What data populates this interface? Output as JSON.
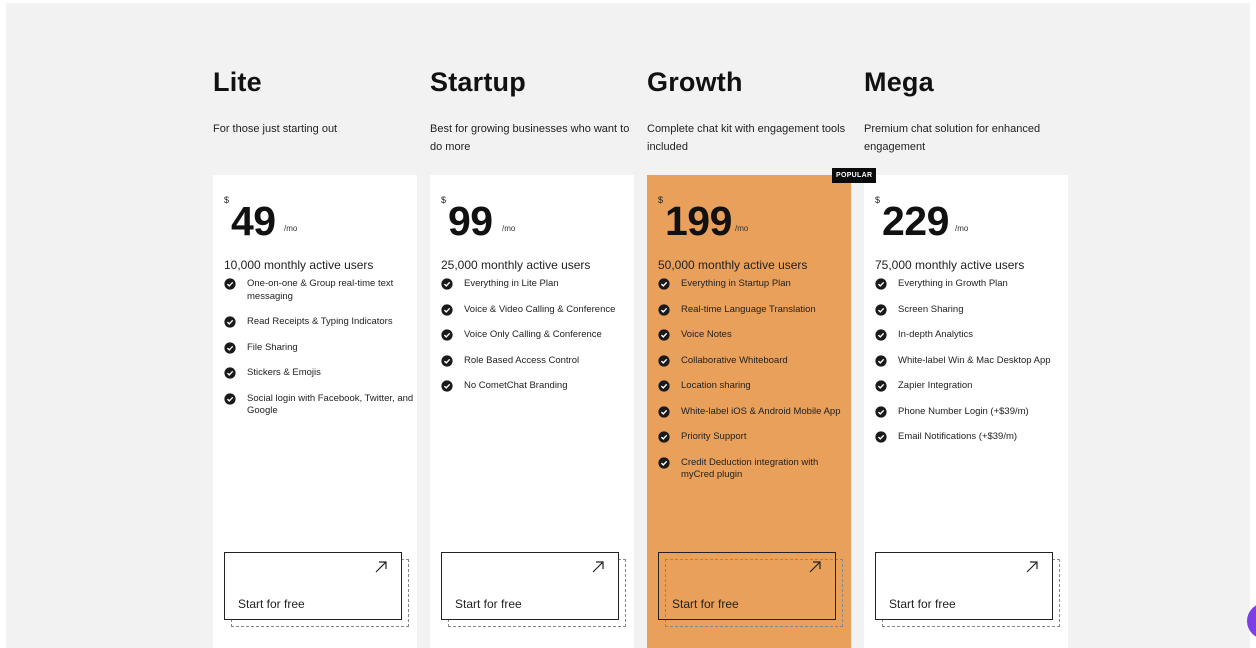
{
  "plans": [
    {
      "name": "Lite",
      "description": "For those just starting out",
      "currency": "$",
      "price": "49",
      "period": "/mo",
      "users": "10,000 monthly active users",
      "features": [
        "One-on-one & Group real-time text messaging",
        "Read Receipts & Typing Indicators",
        "File Sharing",
        "Stickers & Emojis",
        "Social login with Facebook, Twitter, and Google"
      ],
      "cta": "Start for free",
      "featured": false
    },
    {
      "name": "Startup",
      "description": "Best for growing businesses﻿ who want to do more",
      "currency": "$",
      "price": "99",
      "period": "/mo",
      "users": "25,000 monthly active users",
      "features": [
        "Everything in Lite Plan",
        "Voice & Video Calling & Conference",
        "Voice Only Calling & Conference",
        "Role Based Access Control",
        "No CometChat Branding"
      ],
      "cta": "Start for free",
      "featured": false
    },
    {
      "name": "Growth",
      "description": "Complete chat kit with engagement tools included",
      "currency": "$",
      "price": "199",
      "period": "/mo",
      "users": "50,000 monthly active users",
      "features": [
        "Everything in Startup Plan",
        "Real-time Language Translation",
        "Voice Notes",
        "Collaborative Whiteboard",
        "Location sharing",
        "White-label iOS & Android Mobile App",
        "Priority Support",
        "Credit Deduction integration with myCred plugin"
      ],
      "cta": "Start for free",
      "featured": true,
      "badge": "POPULAR"
    },
    {
      "name": "Mega",
      "description": "Premium chat solution for enhanced engagement",
      "currency": "$",
      "price": "229",
      "period": "/mo",
      "users": "75,000 monthly active users",
      "features": [
        "Everything in Growth Plan",
        "Screen Sharing",
        "In-depth Analytics",
        "White-label Win & Mac Desktop App",
        "Zapier Integration",
        "Phone Number Login (+$39/m)",
        "Email Notifications (+$39/m)"
      ],
      "cta": "Start for free",
      "featured": false
    }
  ],
  "colors": {
    "featured_card": "#e8a05a",
    "page_background": "#f2f2f2",
    "badge_background": "#0a0a0a",
    "chat_launcher": "#7b3fe4"
  },
  "icons": {
    "feature": "check-circle-icon",
    "cta": "arrow-up-right-icon",
    "launcher": "chat-launcher-icon"
  }
}
